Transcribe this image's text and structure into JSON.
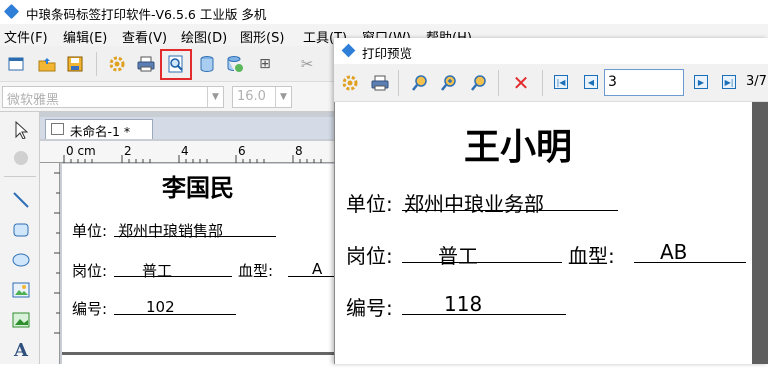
{
  "app": {
    "title": "中琅条码标签打印软件-V6.5.6 工业版 多机",
    "menu": [
      "文件(F)",
      "编辑(E)",
      "查看(V)",
      "绘图(D)",
      "图形(S)",
      "工具(T)",
      "窗口(W)",
      "帮助(H)"
    ]
  },
  "font_bar": {
    "font_name": "微软雅黑",
    "font_size": "16.0"
  },
  "document": {
    "tab_label": "未命名-1 *",
    "ruler_unit": "0 cm",
    "ruler_ticks": [
      "2",
      "4",
      "6",
      "8"
    ],
    "label": {
      "name": "李国民",
      "unit_label": "单位:",
      "unit_value": "郑州中琅销售部",
      "post_label": "岗位:",
      "post_value": "普工",
      "blood_label": "血型:",
      "blood_value": "A",
      "id_label": "编号:",
      "id_value": "102"
    }
  },
  "preview": {
    "title": "打印预览",
    "page_input": "3",
    "page_count": "3/7",
    "label": {
      "name": "王小明",
      "unit_label": "单位:",
      "unit_value": "郑州中琅业务部",
      "post_label": "岗位:",
      "post_value": "普工",
      "blood_label": "血型:",
      "blood_value": "AB",
      "id_label": "编号:",
      "id_value": "118"
    }
  },
  "colors": {
    "highlight": "#e32b2b",
    "arrow": "#e8404a",
    "accent": "#1b6fb8"
  }
}
